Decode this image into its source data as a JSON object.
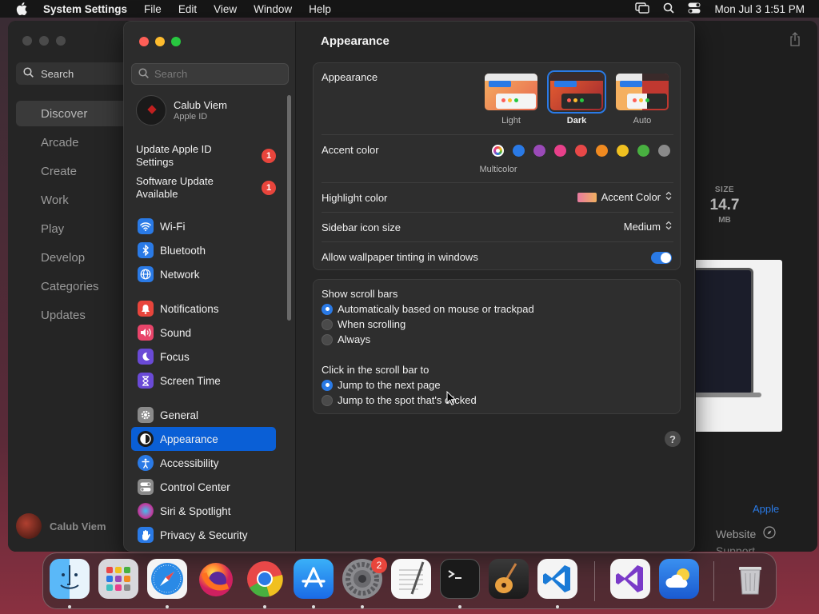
{
  "menubar": {
    "app_name": "System Settings",
    "items": [
      "File",
      "Edit",
      "View",
      "Window",
      "Help"
    ],
    "clock": "Mon Jul 3  1:51 PM"
  },
  "appstore": {
    "search": "Search",
    "nav": [
      "Discover",
      "Arcade",
      "Create",
      "Work",
      "Play",
      "Develop",
      "Categories",
      "Updates"
    ],
    "selected": "Discover",
    "user": "Calub Viem",
    "size_label": "SIZE",
    "size_value": "14.7",
    "size_unit": "MB",
    "developer_link": "Apple",
    "website": "Website",
    "support": "Support"
  },
  "settings": {
    "search_placeholder": "Search",
    "user_name": "Calub Viem",
    "user_sub": "Apple ID",
    "notices": [
      {
        "text": "Update Apple ID Settings",
        "badge": "1"
      },
      {
        "text": "Software Update Available",
        "badge": "1"
      }
    ],
    "nav": [
      {
        "label": "Wi-Fi",
        "icon": "wifi-icon",
        "color": "#2a7ae6"
      },
      {
        "label": "Bluetooth",
        "icon": "bluetooth-icon",
        "color": "#2a7ae6"
      },
      {
        "label": "Network",
        "icon": "globe-icon",
        "color": "#2a7ae6"
      },
      {
        "label": "Notifications",
        "icon": "bell-icon",
        "color": "#e8453c"
      },
      {
        "label": "Sound",
        "icon": "speaker-icon",
        "color": "#e8456a"
      },
      {
        "label": "Focus",
        "icon": "moon-icon",
        "color": "#6a4ad6"
      },
      {
        "label": "Screen Time",
        "icon": "hourglass-icon",
        "color": "#6a4ad6"
      },
      {
        "label": "General",
        "icon": "gear-icon",
        "color": "#8a8a8a"
      },
      {
        "label": "Appearance",
        "icon": "appearance-icon",
        "color": "#1a1a1a"
      },
      {
        "label": "Accessibility",
        "icon": "accessibility-icon",
        "color": "#2a7ae6"
      },
      {
        "label": "Control Center",
        "icon": "toggles-icon",
        "color": "#8a8a8a"
      },
      {
        "label": "Siri & Spotlight",
        "icon": "siri-icon",
        "color": "#c040a0"
      },
      {
        "label": "Privacy & Security",
        "icon": "hand-icon",
        "color": "#2a7ae6"
      }
    ],
    "selected": "Appearance"
  },
  "appearance": {
    "title": "Appearance",
    "appearance_label": "Appearance",
    "modes": [
      "Light",
      "Dark",
      "Auto"
    ],
    "selected_mode": "Dark",
    "accent_label": "Accent color",
    "accent_colors": [
      "multicolor",
      "#2a7ae6",
      "#9a4ab8",
      "#e8408a",
      "#e84848",
      "#f08a20",
      "#f0c020",
      "#48b040",
      "#8a8a8a"
    ],
    "accent_selected_label": "Multicolor",
    "highlight_label": "Highlight color",
    "highlight_value": "Accent Color",
    "sidebar_label": "Sidebar icon size",
    "sidebar_value": "Medium",
    "tinting_label": "Allow wallpaper tinting in windows",
    "tinting_on": true,
    "scrollbars_label": "Show scroll bars",
    "scrollbar_options": [
      "Automatically based on mouse or trackpad",
      "When scrolling",
      "Always"
    ],
    "scrollbar_selected": 0,
    "click_label": "Click in the scroll bar to",
    "click_options": [
      "Jump to the next page",
      "Jump to the spot that's clicked"
    ],
    "click_selected": 0,
    "help": "?"
  },
  "dock": {
    "apps": [
      "Finder",
      "Launchpad",
      "Safari",
      "Firefox",
      "Chrome",
      "App Store",
      "System Settings",
      "TextEdit",
      "Terminal",
      "GarageBand",
      "VS Code",
      "Visual Studio",
      "Weather",
      "Trash"
    ],
    "settings_badge": "2"
  }
}
